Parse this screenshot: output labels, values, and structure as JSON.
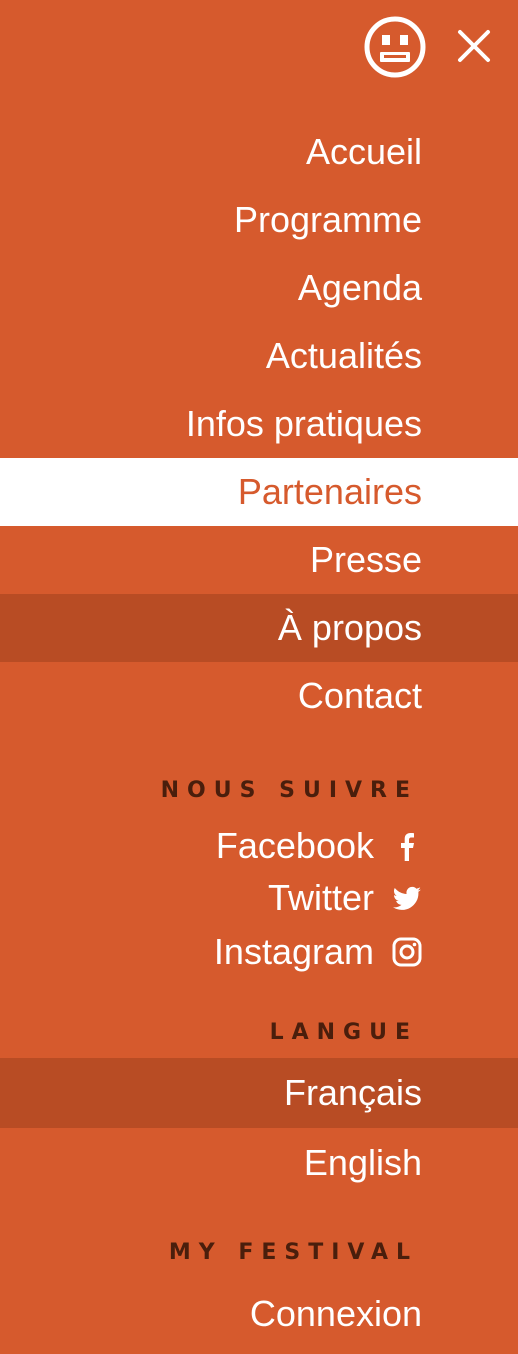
{
  "header": {
    "logo_icon": "neutral-face-icon",
    "close_icon": "close-icon"
  },
  "nav": {
    "items": [
      {
        "label": "Accueil"
      },
      {
        "label": "Programme"
      },
      {
        "label": "Agenda"
      },
      {
        "label": "Actualités"
      },
      {
        "label": "Infos pratiques"
      },
      {
        "label": "Partenaires",
        "state": "active"
      },
      {
        "label": "Presse"
      },
      {
        "label": "À propos",
        "state": "hover"
      },
      {
        "label": "Contact"
      }
    ]
  },
  "follow": {
    "title": "NOUS SUIVRE",
    "links": [
      {
        "label": "Facebook",
        "icon": "facebook-icon"
      },
      {
        "label": "Twitter",
        "icon": "twitter-icon"
      },
      {
        "label": "Instagram",
        "icon": "instagram-icon"
      }
    ]
  },
  "language": {
    "title": "LANGUE",
    "options": [
      {
        "label": "Français",
        "state": "current"
      },
      {
        "label": "English"
      }
    ]
  },
  "my_festival": {
    "title": "MY FESTIVAL",
    "login_label": "Connexion"
  },
  "colors": {
    "background": "#D65A2D",
    "highlight": "#B84C24",
    "active_bg": "#FFFFFF",
    "section_title": "#4A1E0C"
  }
}
